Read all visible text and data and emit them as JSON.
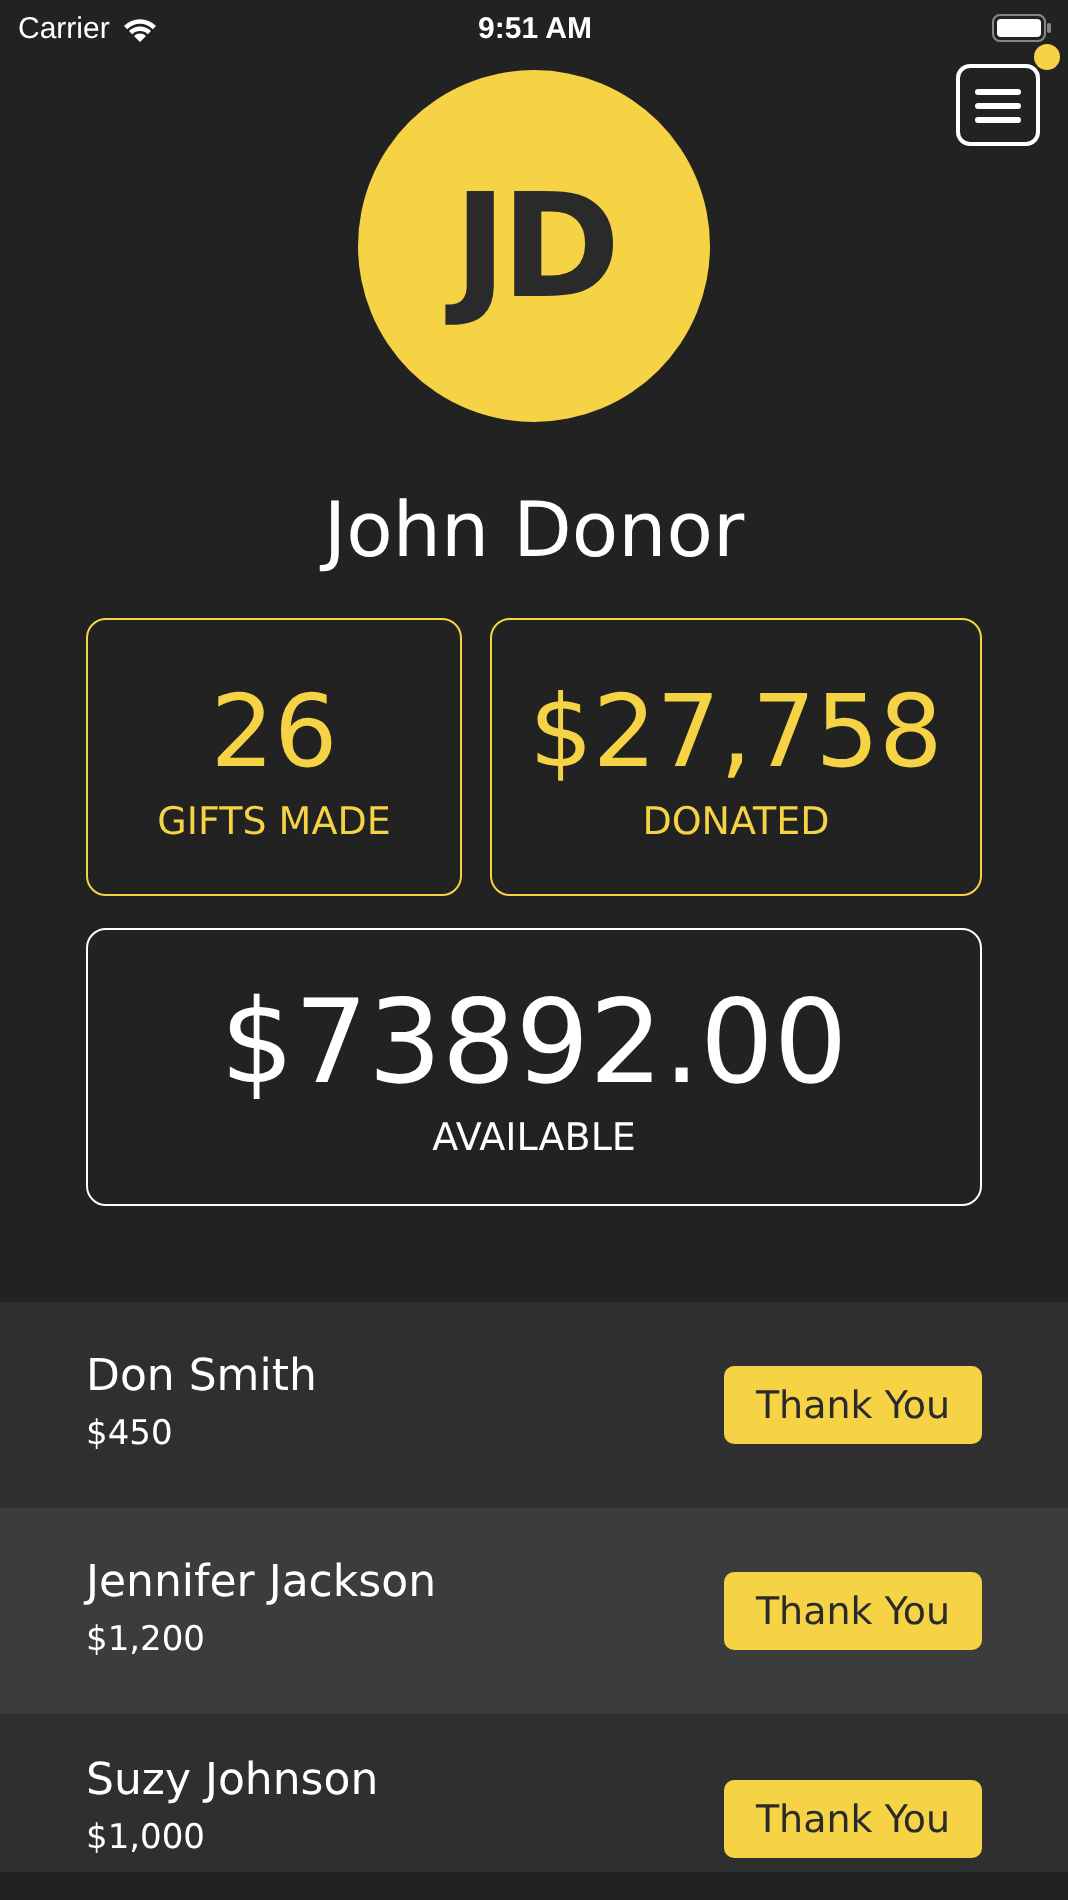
{
  "status_bar": {
    "carrier": "Carrier",
    "time": "9:51 AM"
  },
  "menu": {
    "has_notification": true
  },
  "profile": {
    "initials": "JD",
    "name": "John Donor"
  },
  "stats": [
    {
      "kind": "accent",
      "value": "26",
      "label": "GIFTS MADE"
    },
    {
      "kind": "accent",
      "value": "$27,758",
      "label": "DONATED"
    },
    {
      "kind": "plain",
      "value": "$73892.00",
      "label": "AVAILABLE"
    }
  ],
  "donors": [
    {
      "name": "Don Smith",
      "amount": "$450",
      "button": "Thank You"
    },
    {
      "name": "Jennifer Jackson",
      "amount": "$1,200",
      "button": "Thank You"
    },
    {
      "name": "Suzy Johnson",
      "amount": "$1,000",
      "button": "Thank You"
    }
  ]
}
